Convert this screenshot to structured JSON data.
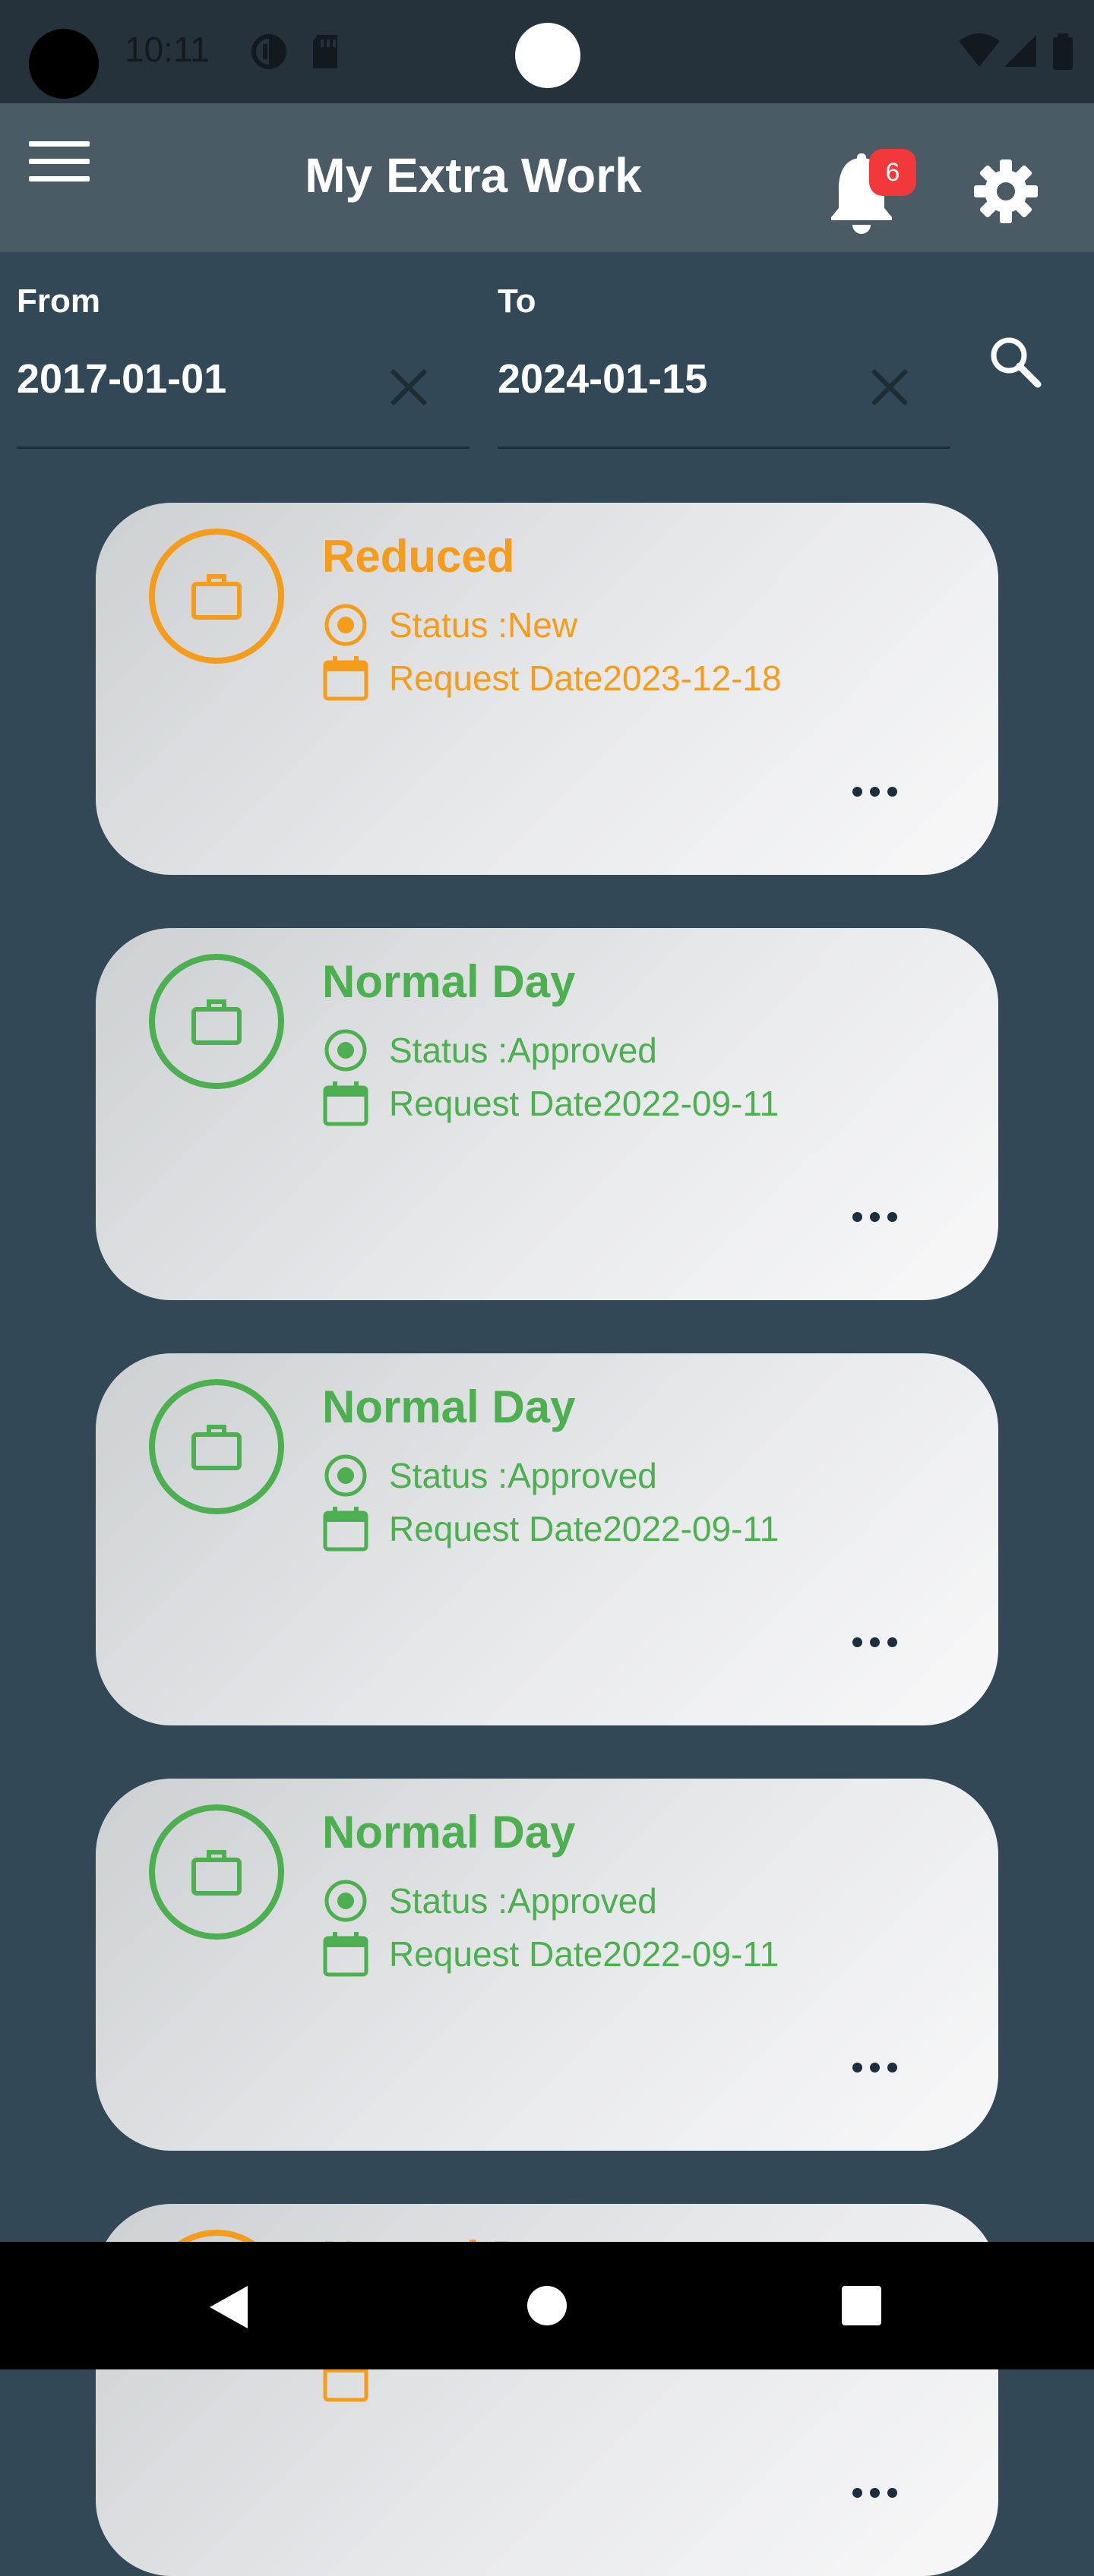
{
  "status_bar": {
    "time": "10:11"
  },
  "app_bar": {
    "title": "My Extra Work",
    "notification_count": "6"
  },
  "filter": {
    "from_label": "From",
    "from_value": "2017-01-01",
    "to_label": "To",
    "to_value": "2024-01-15"
  },
  "requests": [
    {
      "title": "Reduced",
      "status": "Status :New",
      "date": "Request Date2023-12-18",
      "color": "#f59c1a"
    },
    {
      "title": "Normal Day",
      "status": "Status :Approved",
      "date": "Request Date2022-09-11",
      "color": "#4caf50"
    },
    {
      "title": "Normal Day",
      "status": "Status :Approved",
      "date": "Request Date2022-09-11",
      "color": "#4caf50"
    },
    {
      "title": "Normal Day",
      "status": "Status :Approved",
      "date": "Request Date2022-09-11",
      "color": "#4caf50"
    },
    {
      "title": "Normal Day",
      "status": "",
      "date": "",
      "color": "#f59c1a"
    }
  ],
  "colors": {
    "background": "#324857",
    "app_bar": "#4a5b66",
    "status_bar": "#26323b",
    "badge": "#f2383b"
  }
}
